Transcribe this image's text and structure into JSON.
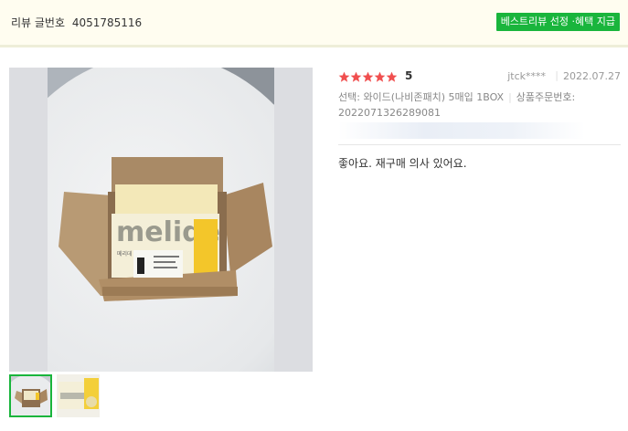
{
  "header": {
    "review_label": "리뷰 글번호",
    "review_number": "4051785116",
    "badge": "베스트리뷰 선정 ·혜택 지급"
  },
  "review": {
    "stars": 5,
    "rating": "5",
    "user": "jtck****",
    "date": "2022.07.27",
    "option_text": "선택: 와이드(나비존패치) 5매입 1BOX",
    "order_label": "상품주문번호:",
    "order_number": "2022071326289081",
    "content": "좋아요. 재구매 의사 있어요."
  },
  "photo": {
    "brand_text": "melide",
    "product_label": "메리데 팬티라이너"
  },
  "colors": {
    "accent": "#19b53c",
    "star": "#f04f4f",
    "header_bg": "#fffdf0"
  },
  "icons": [
    "star-icon"
  ]
}
